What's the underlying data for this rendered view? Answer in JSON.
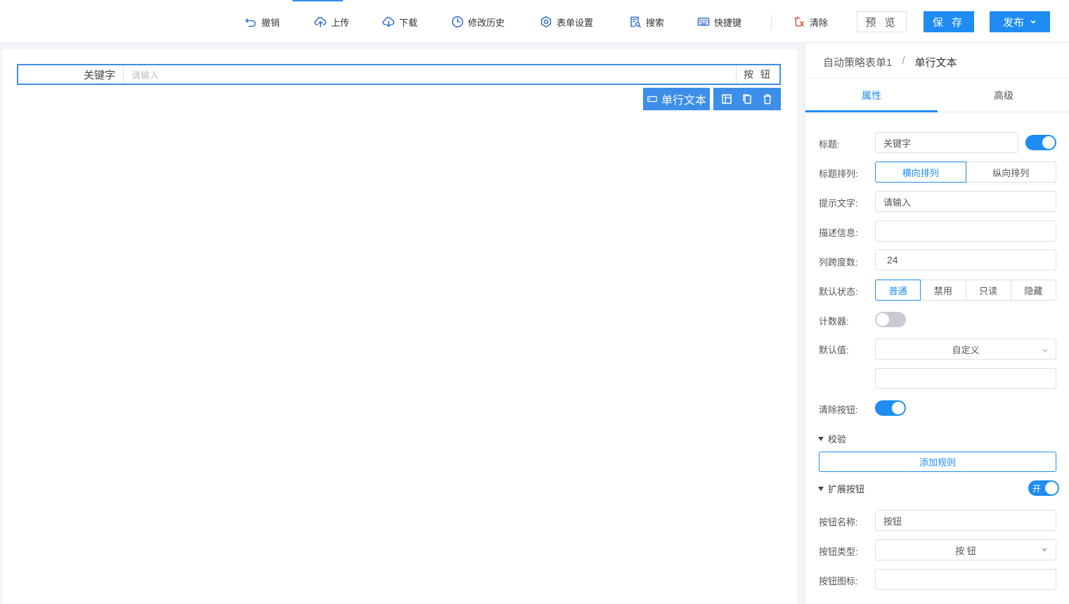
{
  "toolbar": {
    "undo": "撤销",
    "upload": "上传",
    "download": "下载",
    "history": "修改历史",
    "form_settings": "表单设置",
    "search": "搜索",
    "shortcuts": "快捷键",
    "clear": "清除",
    "preview": "预 览",
    "save": "保 存",
    "publish": "发布"
  },
  "canvas": {
    "field_label": "关键字",
    "field_placeholder": "请输入",
    "field_button": "按 钮",
    "component_tag": "单行文本"
  },
  "panel": {
    "breadcrumb_form": "自动策略表单1",
    "breadcrumb_sep": "/",
    "breadcrumb_component": "单行文本",
    "tab_props": "属性",
    "tab_advanced": "高级",
    "title_label": "标题:",
    "title_value": "关键字",
    "title_layout_label": "标题排列:",
    "layout_horizontal": "横向排列",
    "layout_vertical": "纵向排列",
    "placeholder_label": "提示文字:",
    "placeholder_value": "请输入",
    "desc_label": "描述信息:",
    "desc_value": "",
    "span_label": "列跨度数:",
    "span_value": "24",
    "state_label": "默认状态:",
    "state_normal": "普通",
    "state_disabled": "禁用",
    "state_readonly": "只读",
    "state_hidden": "隐藏",
    "counter_label": "计数器:",
    "default_label": "默认值:",
    "default_mode": "自定义",
    "default_value": "",
    "clear_btn_label": "清除按钮:",
    "validation_title": "校验",
    "add_rule": "添加规则",
    "ext_btn_title": "扩展按钮",
    "ext_toggle_text": "开",
    "btn_name_label": "按钮名称:",
    "btn_name_value": "按钮",
    "btn_type_label": "按钮类型:",
    "btn_type_value": "按 钮",
    "btn_icon_label": "按钮图标:",
    "btn_icon_value": ""
  },
  "colors": {
    "accent": "#1e8cf2",
    "canvas_select": "#3d8ee8",
    "danger": "#e0564a"
  },
  "icons": [
    "undo-icon",
    "upload-icon",
    "download-icon",
    "history-icon",
    "settings-icon",
    "search-icon",
    "keyboard-icon",
    "clear-icon",
    "chevron-down-icon",
    "input-icon",
    "layout-icon",
    "copy-icon",
    "trash-icon"
  ]
}
